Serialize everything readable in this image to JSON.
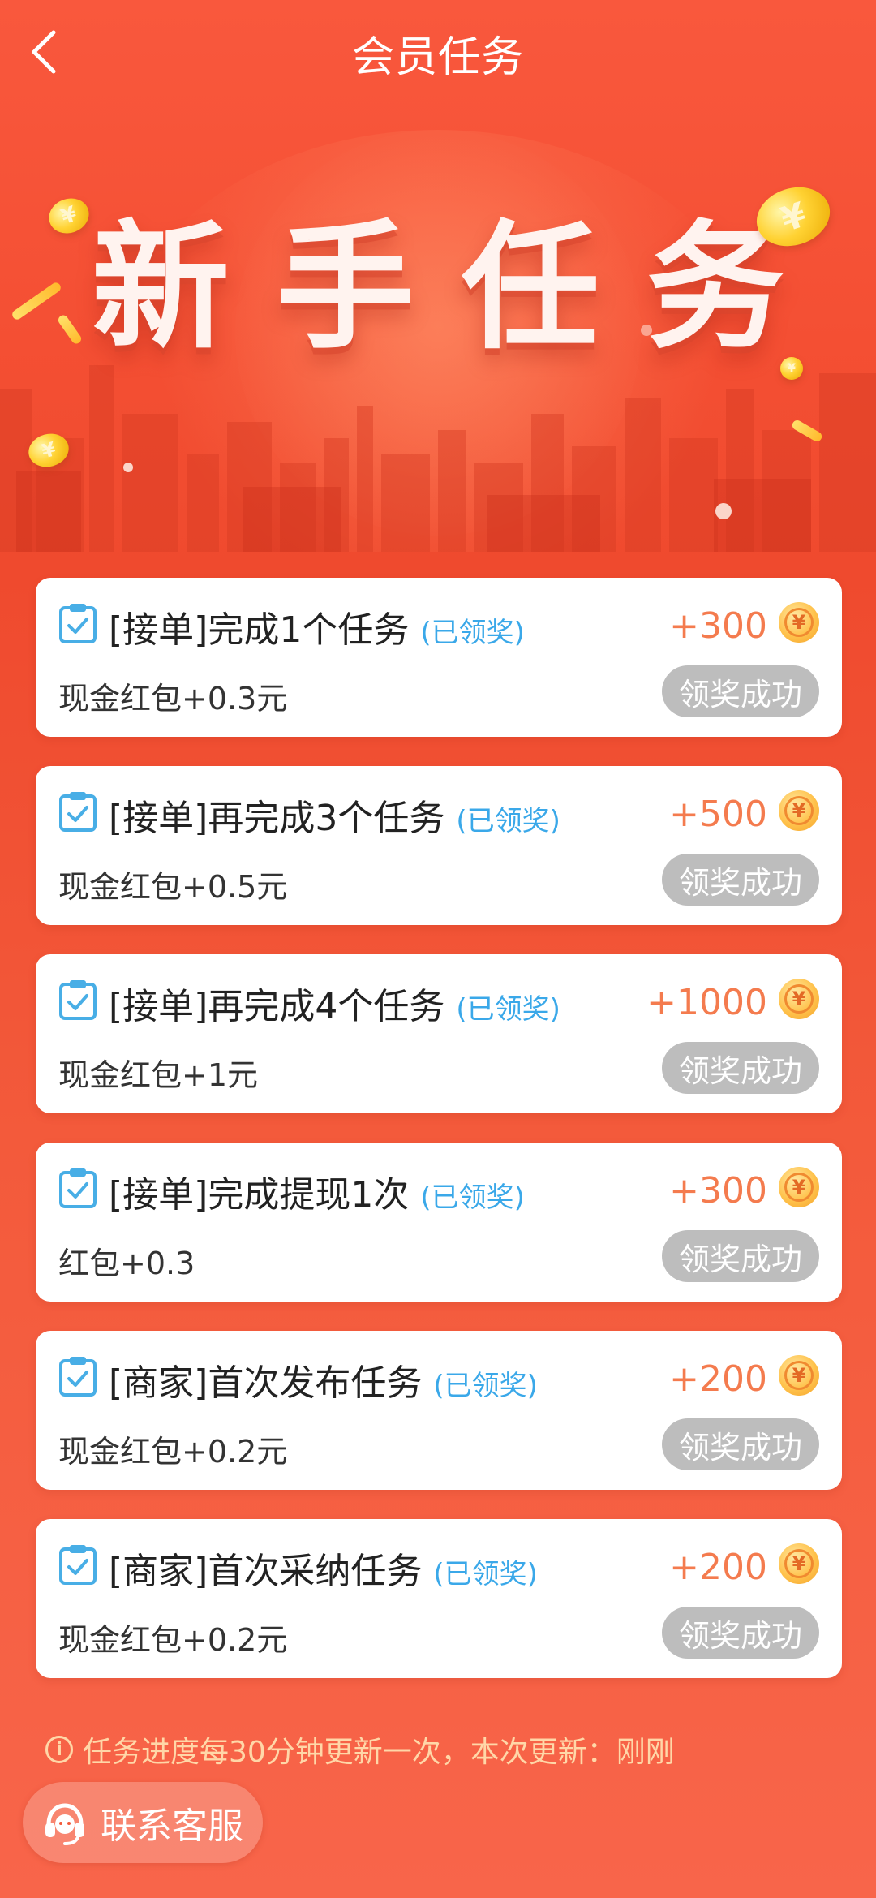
{
  "header": {
    "title": "会员任务",
    "back_icon": "chevron-left-icon"
  },
  "banner": {
    "title": "新手任务"
  },
  "colors": {
    "background": "#f44f33",
    "claimed": "#3aa8e9",
    "points": "#f47b4e",
    "button_disabled": "#bdbdbd",
    "notice": "#ffd7a8"
  },
  "tasks": [
    {
      "title": "[接单]完成1个任务",
      "status": "(已领奖)",
      "points": "+300",
      "reward": "现金红包+0.3元",
      "button": "领奖成功"
    },
    {
      "title": "[接单]再完成3个任务",
      "status": "(已领奖)",
      "points": "+500",
      "reward": "现金红包+0.5元",
      "button": "领奖成功"
    },
    {
      "title": "[接单]再完成4个任务",
      "status": "(已领奖)",
      "points": "+1000",
      "reward": "现金红包+1元",
      "button": "领奖成功"
    },
    {
      "title": "[接单]完成提现1次",
      "status": "(已领奖)",
      "points": "+300",
      "reward": "红包+0.3",
      "button": "领奖成功"
    },
    {
      "title": "[商家]首次发布任务",
      "status": "(已领奖)",
      "points": "+200",
      "reward": "现金红包+0.2元",
      "button": "领奖成功"
    },
    {
      "title": "[商家]首次采纳任务",
      "status": "(已领奖)",
      "points": "+200",
      "reward": "现金红包+0.2元",
      "button": "领奖成功"
    }
  ],
  "coin_symbol": "¥",
  "footer": {
    "info_icon": "i",
    "notice": "任务进度每30分钟更新一次，本次更新：刚刚",
    "contact_label": "联系客服",
    "contact_icon": "headset-icon"
  }
}
